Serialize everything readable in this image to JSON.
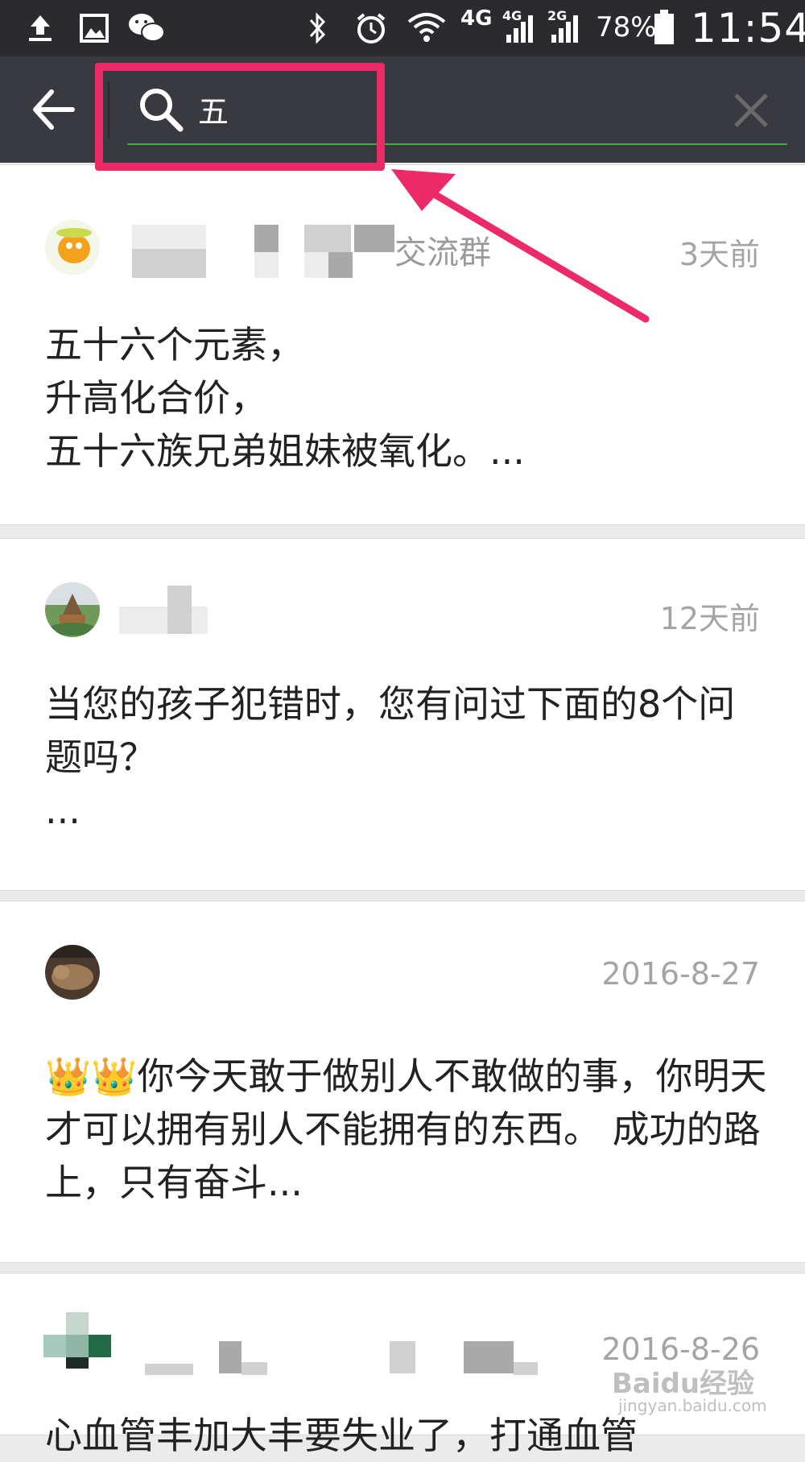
{
  "status_bar": {
    "network_4g": "4G",
    "signal_4g_label": "4G",
    "signal_2g_label": "2G",
    "battery": "78%",
    "time": "11:54"
  },
  "search": {
    "query": "五",
    "accent_color": "#46a64b",
    "highlight_color": "#ec2a68"
  },
  "results": [
    {
      "name_visible": "交流群",
      "time": "3天前",
      "snippet": "五十六个元素，\n升高化合价，\n五十六族兄弟姐妹被氧化。..."
    },
    {
      "time": "12天前",
      "snippet": "当您的孩子犯错时，您有问过下面的8个问题吗？\n..."
    },
    {
      "time": "2016-8-27",
      "snippet": "👑👑你今天敢于做别人不敢做的事，你明天才可以拥有别人不能拥有的东西。 成功的路上，只有奋斗..."
    },
    {
      "time": "2016-8-26",
      "snippet": "心血管丰加大丰要失业了，打通血管"
    }
  ],
  "watermark": {
    "main": "Baidu经验",
    "sub": "jingyan.baidu.com"
  }
}
